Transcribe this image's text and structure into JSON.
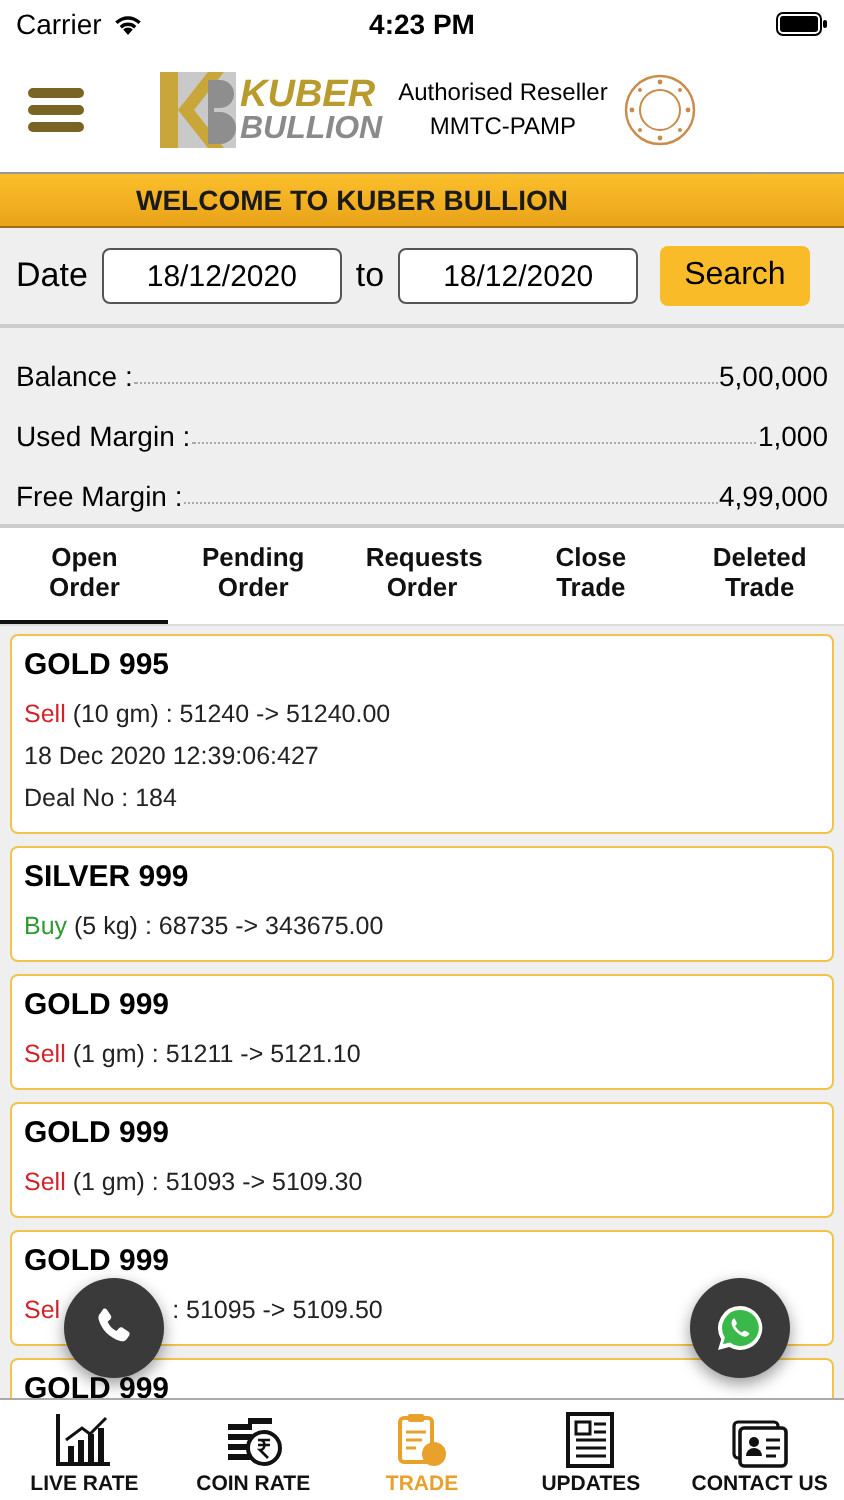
{
  "status_bar": {
    "carrier": "Carrier",
    "time": "4:23 PM"
  },
  "header": {
    "logo_top": "KUBER",
    "logo_bottom": "BULLION",
    "reseller_line_1": "Authorised Reseller",
    "reseller_line_2": "MMTC-PAMP"
  },
  "welcome": "WELCOME TO KUBER BULLION",
  "date_filter": {
    "label": "Date",
    "from": "18/12/2020",
    "separator": "to",
    "to": "18/12/2020",
    "button": "Search"
  },
  "balances": [
    {
      "label": "Balance :",
      "value": "5,00,000"
    },
    {
      "label": "Used Margin :",
      "value": "1,000"
    },
    {
      "label": "Free Margin :",
      "value": "4,99,000"
    }
  ],
  "tabs": [
    {
      "label": "Open Order",
      "selected": true
    },
    {
      "label": "Pending Order",
      "selected": false
    },
    {
      "label": "Requests Order",
      "selected": false
    },
    {
      "label": "Close Trade",
      "selected": false
    },
    {
      "label": "Deleted Trade",
      "selected": false
    }
  ],
  "orders": [
    {
      "title": "GOLD 995",
      "side": "Sell",
      "kind": "sell",
      "detail": "(10 gm) : 51240 -> 51240.00",
      "extra": [
        "18 Dec 2020 12:39:06:427",
        "Deal No : 184"
      ]
    },
    {
      "title": "SILVER 999",
      "side": "Buy",
      "kind": "buy",
      "detail": "(5 kg) : 68735 -> 343675.00"
    },
    {
      "title": "GOLD 999",
      "side": "Sell",
      "kind": "sell",
      "detail": "(1 gm) : 51211 -> 5121.10"
    },
    {
      "title": "GOLD 999",
      "side": "Sell",
      "kind": "sell",
      "detail": "(1 gm) : 51093 -> 5109.30"
    },
    {
      "title": "GOLD 999",
      "side": "Sel",
      "kind": "sell",
      "detail": ": 51095 -> 5109.50",
      "covered": true
    },
    {
      "title": "GOLD 999"
    }
  ],
  "bottom_nav": [
    {
      "label": "LIVE RATE",
      "kind": "chart",
      "selected": false
    },
    {
      "label": "COIN RATE",
      "kind": "coins",
      "selected": false
    },
    {
      "label": "TRADE",
      "kind": "clipboard",
      "selected": true
    },
    {
      "label": "UPDATES",
      "kind": "news",
      "selected": false
    },
    {
      "label": "CONTACT US",
      "kind": "contact",
      "selected": false
    }
  ]
}
